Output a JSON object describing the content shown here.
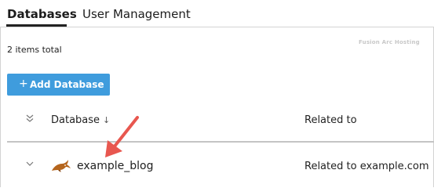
{
  "tabs": [
    {
      "label": "Databases",
      "active": true
    },
    {
      "label": "User Management",
      "active": false
    }
  ],
  "watermark": "Fusion Arc Hosting",
  "summary": {
    "total_text": "2 items total"
  },
  "toolbar": {
    "add_icon": "+",
    "add_label": "Add Database"
  },
  "table": {
    "columns": {
      "database": "Database",
      "database_sort_icon": "↓",
      "related": "Related to"
    },
    "rows": [
      {
        "name": "example_blog",
        "related": "Related to example.com",
        "icon": "mysql-dolphin-icon"
      }
    ]
  },
  "colors": {
    "accent": "#3f9cdd",
    "annotation_arrow": "#e8574f",
    "divider": "#d3d3d3"
  }
}
